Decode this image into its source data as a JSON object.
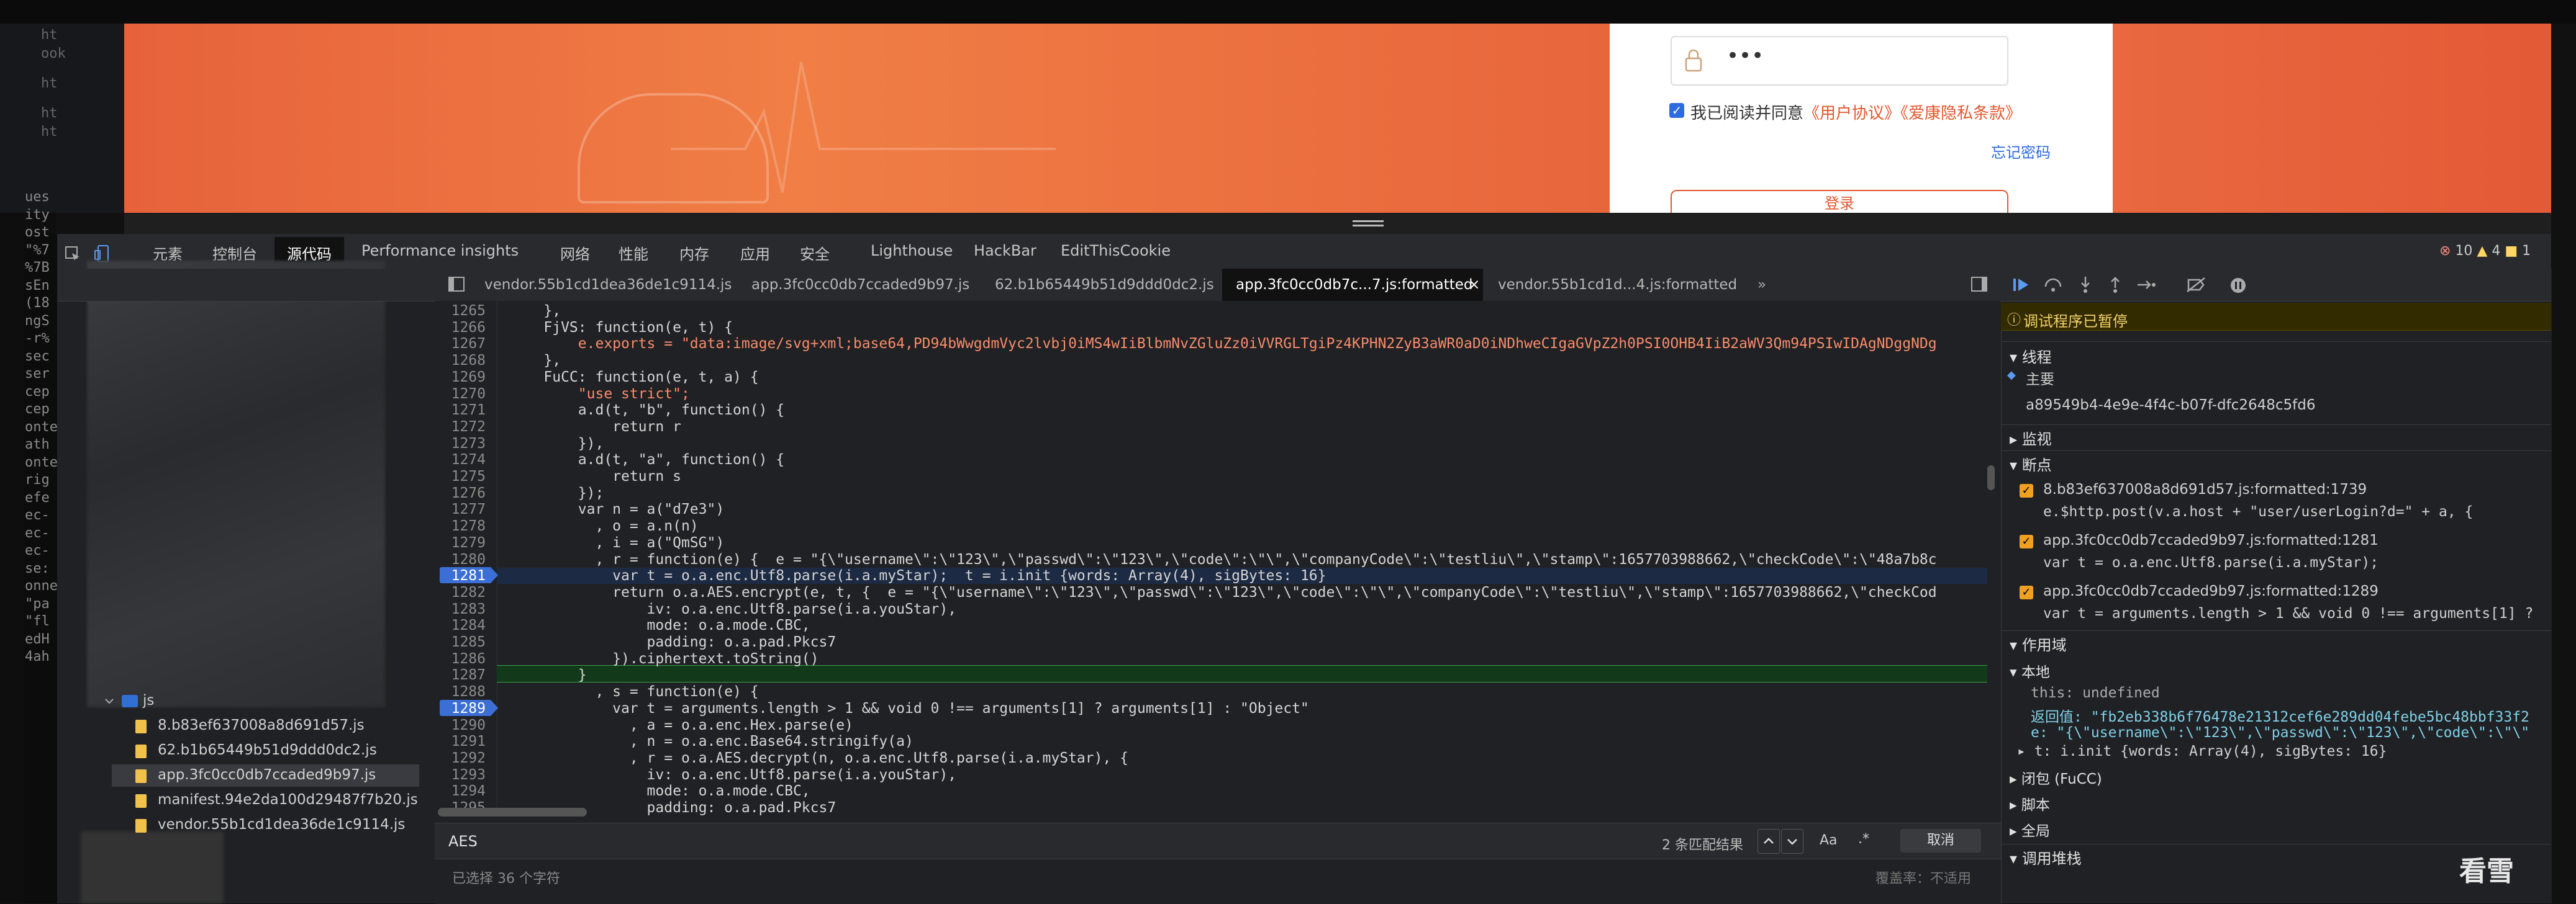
{
  "page": {
    "left_strip_lines": [
      "ht",
      "ook",
      "ht",
      "ht",
      "ht"
    ],
    "left_cut_lines": [
      "ues",
      "ity",
      "ost",
      "\"%7",
      "%7B",
      "sEn",
      "(18",
      "ngS",
      "-r%",
      "sec",
      "ser",
      "cep",
      "cep",
      "onte",
      "ath",
      "onte",
      "rig",
      "efe",
      "ec-",
      "ec-",
      "ec-",
      "se:",
      "onne",
      "\"pa",
      "\"fl",
      "edH",
      "4ah"
    ],
    "login": {
      "password_value": "•••",
      "agree_text": "我已阅读并同意",
      "agree_link1": "《用户协议》",
      "agree_link2": "《爱康隐私条款》",
      "forgot_password": "忘记密码",
      "login_button": "登录"
    }
  },
  "devtools": {
    "main_tabs": [
      "元素",
      "控制台",
      "源代码",
      "Performance insights",
      "网络",
      "性能",
      "内存",
      "应用",
      "安全",
      "Lighthouse",
      "HackBar",
      "EditThisCookie"
    ],
    "active_main_tab": "源代码",
    "errors": "10",
    "warnings": "4",
    "issues": "1",
    "editor_tabs": [
      "vendor.55b1cd1dea36de1c9114.js",
      "app.3fc0cc0db7ccaded9b97.js",
      "62.b1b65449b51d9ddd0dc2.js",
      "app.3fc0cc0db7c...7.js:formatted",
      "vendor.55b1cd1d...4.js:formatted"
    ],
    "active_editor_tab": "app.3fc0cc0db7c...7.js:formatted",
    "navigator": {
      "folder": "js",
      "files": [
        "8.b83ef637008a8d691d57.js",
        "62.b1b65449b51d9ddd0dc2.js",
        "app.3fc0cc0db7ccaded9b97.js",
        "manifest.94e2da100d29487f7b20.js",
        "vendor.55b1cd1dea36de1c9114.js"
      ],
      "selected": "app.3fc0cc0db7ccaded9b97.js"
    },
    "code_lines": [
      {
        "n": "1265",
        "t": "    },"
      },
      {
        "n": "1266",
        "t": "    FjVS: function(e, t) {"
      },
      {
        "n": "1267",
        "t": "        e.exports = \"data:image/svg+xml;base64,PD94bWwgdmVyc2lvbj0iMS4wIiBlbmNvZGluZz0iVVRGLTgiPz4KPHN2ZyB3aWR0aD0iNDhweCIgaGVpZ2h0PSI0OHB4IiB2aWV3Qm94PSIwIDAgNDggNDg"
      },
      {
        "n": "1268",
        "t": "    },"
      },
      {
        "n": "1269",
        "t": "    FuCC: function(e, t, a) {"
      },
      {
        "n": "1270",
        "t": "        \"use strict\";"
      },
      {
        "n": "1271",
        "t": "        a.d(t, \"b\", function() {"
      },
      {
        "n": "1272",
        "t": "            return r"
      },
      {
        "n": "1273",
        "t": "        }),"
      },
      {
        "n": "1274",
        "t": "        a.d(t, \"a\", function() {"
      },
      {
        "n": "1275",
        "t": "            return s"
      },
      {
        "n": "1276",
        "t": "        });"
      },
      {
        "n": "1277",
        "t": "        var n = a(\"d7e3\")"
      },
      {
        "n": "1278",
        "t": "          , o = a.n(n)"
      },
      {
        "n": "1279",
        "t": "          , i = a(\"QmSG\")"
      },
      {
        "n": "1280",
        "t": "          , r = function(e) {  e = \"{\\\"username\\\":\\\"123\\\",\\\"passwd\\\":\\\"123\\\",\\\"code\\\":\\\"\\\",\\\"companyCode\\\":\\\"testliu\\\",\\\"stamp\\\":1657703988662,\\\"checkCode\\\":\\\"48a7b8c"
      },
      {
        "n": "1281",
        "t": "            var t = o.a.enc.Utf8.parse(i.a.myStar);  t = i.init {words: Array(4), sigBytes: 16}"
      },
      {
        "n": "1282",
        "t": "            return o.a.AES.encrypt(e, t, {  e = \"{\\\"username\\\":\\\"123\\\",\\\"passwd\\\":\\\"123\\\",\\\"code\\\":\\\"\\\",\\\"companyCode\\\":\\\"testliu\\\",\\\"stamp\\\":1657703988662,\\\"checkCod"
      },
      {
        "n": "1283",
        "t": "                iv: o.a.enc.Utf8.parse(i.a.youStar),"
      },
      {
        "n": "1284",
        "t": "                mode: o.a.mode.CBC,"
      },
      {
        "n": "1285",
        "t": "                padding: o.a.pad.Pkcs7"
      },
      {
        "n": "1286",
        "t": "            }).ciphertext.toString()"
      },
      {
        "n": "1287",
        "t": "        }"
      },
      {
        "n": "1288",
        "t": "          , s = function(e) {"
      },
      {
        "n": "1289",
        "t": "            var t = arguments.length > 1 && void 0 !== arguments[1] ? arguments[1] : \"Object\""
      },
      {
        "n": "1290",
        "t": "              , a = o.a.enc.Hex.parse(e)"
      },
      {
        "n": "1291",
        "t": "              , n = o.a.enc.Base64.stringify(a)"
      },
      {
        "n": "1292",
        "t": "              , r = o.a.AES.decrypt(n, o.a.enc.Utf8.parse(i.a.myStar), {"
      },
      {
        "n": "1293",
        "t": "                iv: o.a.enc.Utf8.parse(i.a.youStar),"
      },
      {
        "n": "1294",
        "t": "                mode: o.a.mode.CBC,"
      },
      {
        "n": "1295",
        "t": "                padding: o.a.pad.Pkcs7"
      }
    ],
    "search": {
      "query": "AES",
      "match_count": "2 条匹配结果",
      "case_label": "Aa",
      "regex_label": ".*",
      "cancel_label": "取消"
    },
    "status": {
      "left": "已选择 36 个字符",
      "right": "覆盖率：不适用"
    },
    "debugger": {
      "paused_banner": "调试程序已暂停",
      "threads_label": "线程",
      "main_thread": "主要",
      "thread_id": "a89549b4-4e9e-4f4c-b07f-dfc2648c5fd6",
      "watch_label": "监视",
      "breakpoints_label": "断点",
      "breakpoints": [
        {
          "file": "8.b83ef637008a8d691d57.js:formatted:1739",
          "code": "e.$http.post(v.a.host + \"user/userLogin?d=\" + a, {"
        },
        {
          "file": "app.3fc0cc0db7ccaded9b97.js:formatted:1281",
          "code": "var t = o.a.enc.Utf8.parse(i.a.myStar);"
        },
        {
          "file": "app.3fc0cc0db7ccaded9b97.js:formatted:1289",
          "code": "var t = arguments.length > 1 && void 0 !== arguments[1] ?"
        }
      ],
      "scope_label": "作用域",
      "local_label": "本地",
      "scope_this": "this: undefined",
      "scope_return": "返回值: \"fb2eb338b6f76478e21312cef6e289dd04febe5bc48bbf33f2",
      "scope_e": "e: \"{\\\"username\\\":\\\"123\\\",\\\"passwd\\\":\\\"123\\\",\\\"code\\\":\\\"\\\"",
      "scope_t": "t: i.init {words: Array(4), sigBytes: 16}",
      "closure_label": "闭包 (FuCC)",
      "script_label": "脚本",
      "global_label": "全局",
      "callstack_label": "调用堆栈"
    }
  },
  "watermark": "看雪",
  "colors": {
    "accent_orange": "#e4572e",
    "paused_green": "#12391a",
    "breakpoint_blue": "#3b6fd6"
  }
}
